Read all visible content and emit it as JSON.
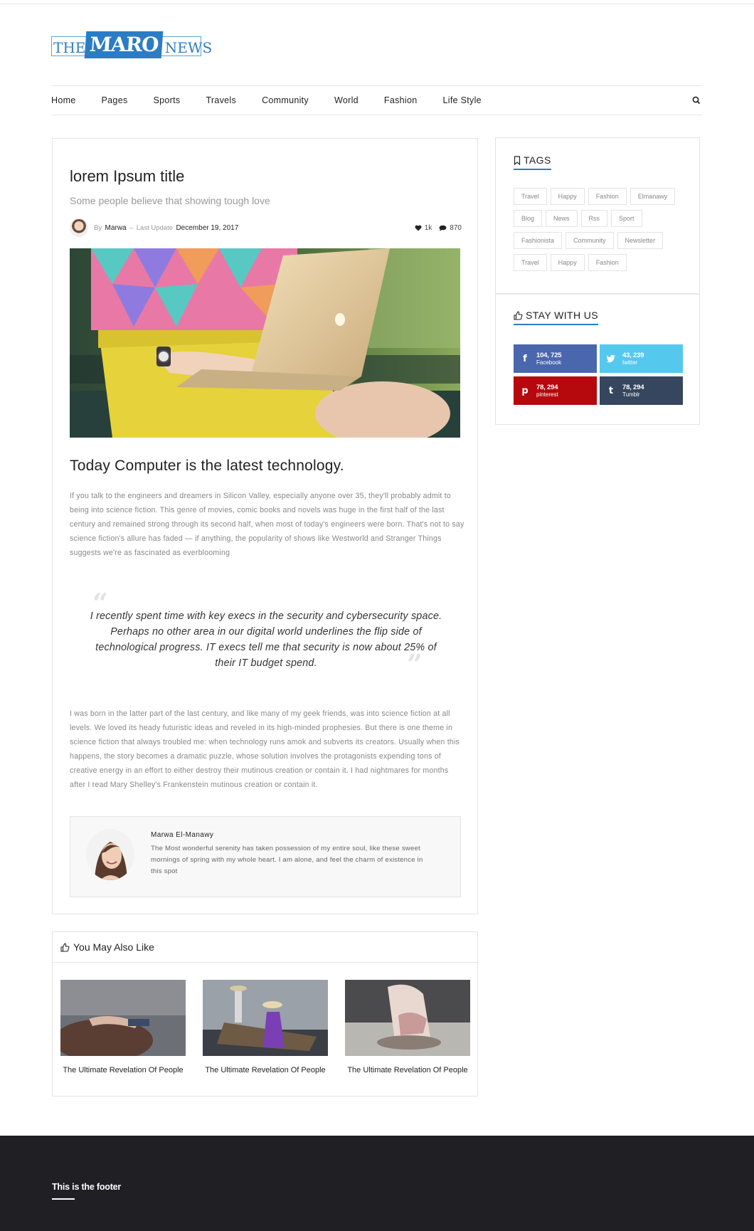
{
  "logo": {
    "part1": "THE",
    "part2": "MARO",
    "part3": "NEWS"
  },
  "nav": {
    "items": [
      "Home",
      "Pages",
      "Sports",
      "Travels",
      "Community",
      "World",
      "Fashion",
      "Life Style"
    ],
    "search_icon": "search-icon"
  },
  "article": {
    "title": "lorem Ipsum title",
    "subtitle": "Some people believe that showing tough love",
    "by_label": "By",
    "author": "Marwa",
    "separator": "–",
    "updated_label": "Last Update",
    "date": "December 19, 2017",
    "likes": "1k",
    "comments": "870",
    "heading": "Today Computer is the latest technology.",
    "paragraph1": "If you talk to the engineers and dreamers in Silicon Valley, especially anyone over 35, they'll probably admit to being into science fiction. This genre of movies, comic books and novels was huge in the first half of the last century and remained strong through its second half, when most of today's engineers were born. That's not to say science fiction's allure has faded — if anything, the popularity of shows like Westworld and Stranger Things suggests we're as fascinated as everblooming",
    "quote": "I recently spent time with key execs in the security and cybersecurity space. Perhaps no other area in our digital world underlines the flip side of technological progress. IT execs tell me that security is now about 25% of their IT budget spend.",
    "paragraph2": "I was born in the latter part of the last century, and like many of my geek friends, was into science fiction at all levels. We loved its heady futuristic ideas and reveled in its high-minded prophesies. But there is one theme in science fiction that always troubled me: when technology runs amok and subverts its creators. Usually when this happens, the story becomes a dramatic puzzle, whose solution involves the protagonists expending tons of creative energy in an effort to either destroy their mutinous creation or contain it. I had nightmares for months after I read Mary Shelley's Frankenstein mutinous creation or contain it.",
    "author_box": {
      "name": "Marwa El-Manawy",
      "bio": "The Most wonderful serenity has taken possession of my entire soul, like these sweet mornings of spring with my whole heart. I am alone, and feel the charm of existence in this spot"
    }
  },
  "related": {
    "heading": "You May Also Like",
    "items": [
      {
        "caption": "The Ultimate Revelation Of People"
      },
      {
        "caption": "The Ultimate Revelation Of People"
      },
      {
        "caption": "The Ultimate Revelation Of People"
      }
    ]
  },
  "sidebar": {
    "tags_title": "TAGS",
    "tag_rows": [
      [
        "Travel",
        "Happy",
        "Fashion",
        "Elmanawy"
      ],
      [
        "Blog",
        "News",
        "Rss",
        "Sport"
      ],
      [
        "Fashionista",
        "Community",
        "Newsletter"
      ],
      [
        "Travel",
        "Happy",
        "Fashion"
      ]
    ],
    "stay_title": "STAY WITH US",
    "social": {
      "facebook": {
        "count": "104, 725",
        "label": "Facebook",
        "color": "#4a67ad"
      },
      "twitter": {
        "count": "43, 239",
        "label": "twitter",
        "color": "#55c8ee"
      },
      "pinterest": {
        "count": "78, 294",
        "label": "pinterest",
        "color": "#b5090e"
      },
      "tumblr": {
        "count": "78, 294",
        "label": "Tumblr",
        "color": "#35465e"
      }
    }
  },
  "footer": {
    "title": "This is the footer"
  },
  "colors": {
    "accent": "#2b7cc4",
    "footer_bg": "#1f1f24"
  }
}
